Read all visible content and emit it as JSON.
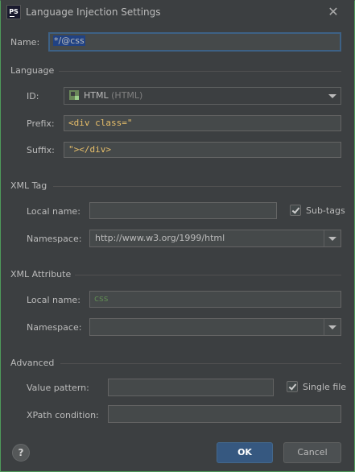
{
  "window": {
    "title": "Language Injection Settings",
    "app_icon": "PS"
  },
  "name": {
    "label": "Name:",
    "value": "*/@css"
  },
  "language": {
    "section": "Language",
    "id_label": "ID:",
    "id_value": "HTML",
    "id_suffix": "(HTML)",
    "id_icon": "html-file-icon",
    "prefix_label": "Prefix:",
    "prefix_value": "<div class=\"",
    "suffix_label": "Suffix:",
    "suffix_value": "\"></div>"
  },
  "xml_tag": {
    "section": "XML Tag",
    "local_name_label": "Local name:",
    "local_name_value": "",
    "subtags_label": "Sub-tags",
    "subtags_checked": true,
    "namespace_label": "Namespace:",
    "namespace_value": "http://www.w3.org/1999/html"
  },
  "xml_attribute": {
    "section": "XML Attribute",
    "local_name_label": "Local name:",
    "local_name_value": "css",
    "namespace_label": "Namespace:",
    "namespace_value": ""
  },
  "advanced": {
    "section": "Advanced",
    "value_pattern_label": "Value pattern:",
    "value_pattern_value": "",
    "single_file_label": "Single file",
    "single_file_checked": true,
    "xpath_label": "XPath condition:",
    "xpath_value": ""
  },
  "buttons": {
    "help": "?",
    "ok": "OK",
    "cancel": "Cancel"
  },
  "colors": {
    "background": "#3c3f41",
    "accent": "#365880",
    "code": "#e8bf6a",
    "selection": "#214283"
  }
}
